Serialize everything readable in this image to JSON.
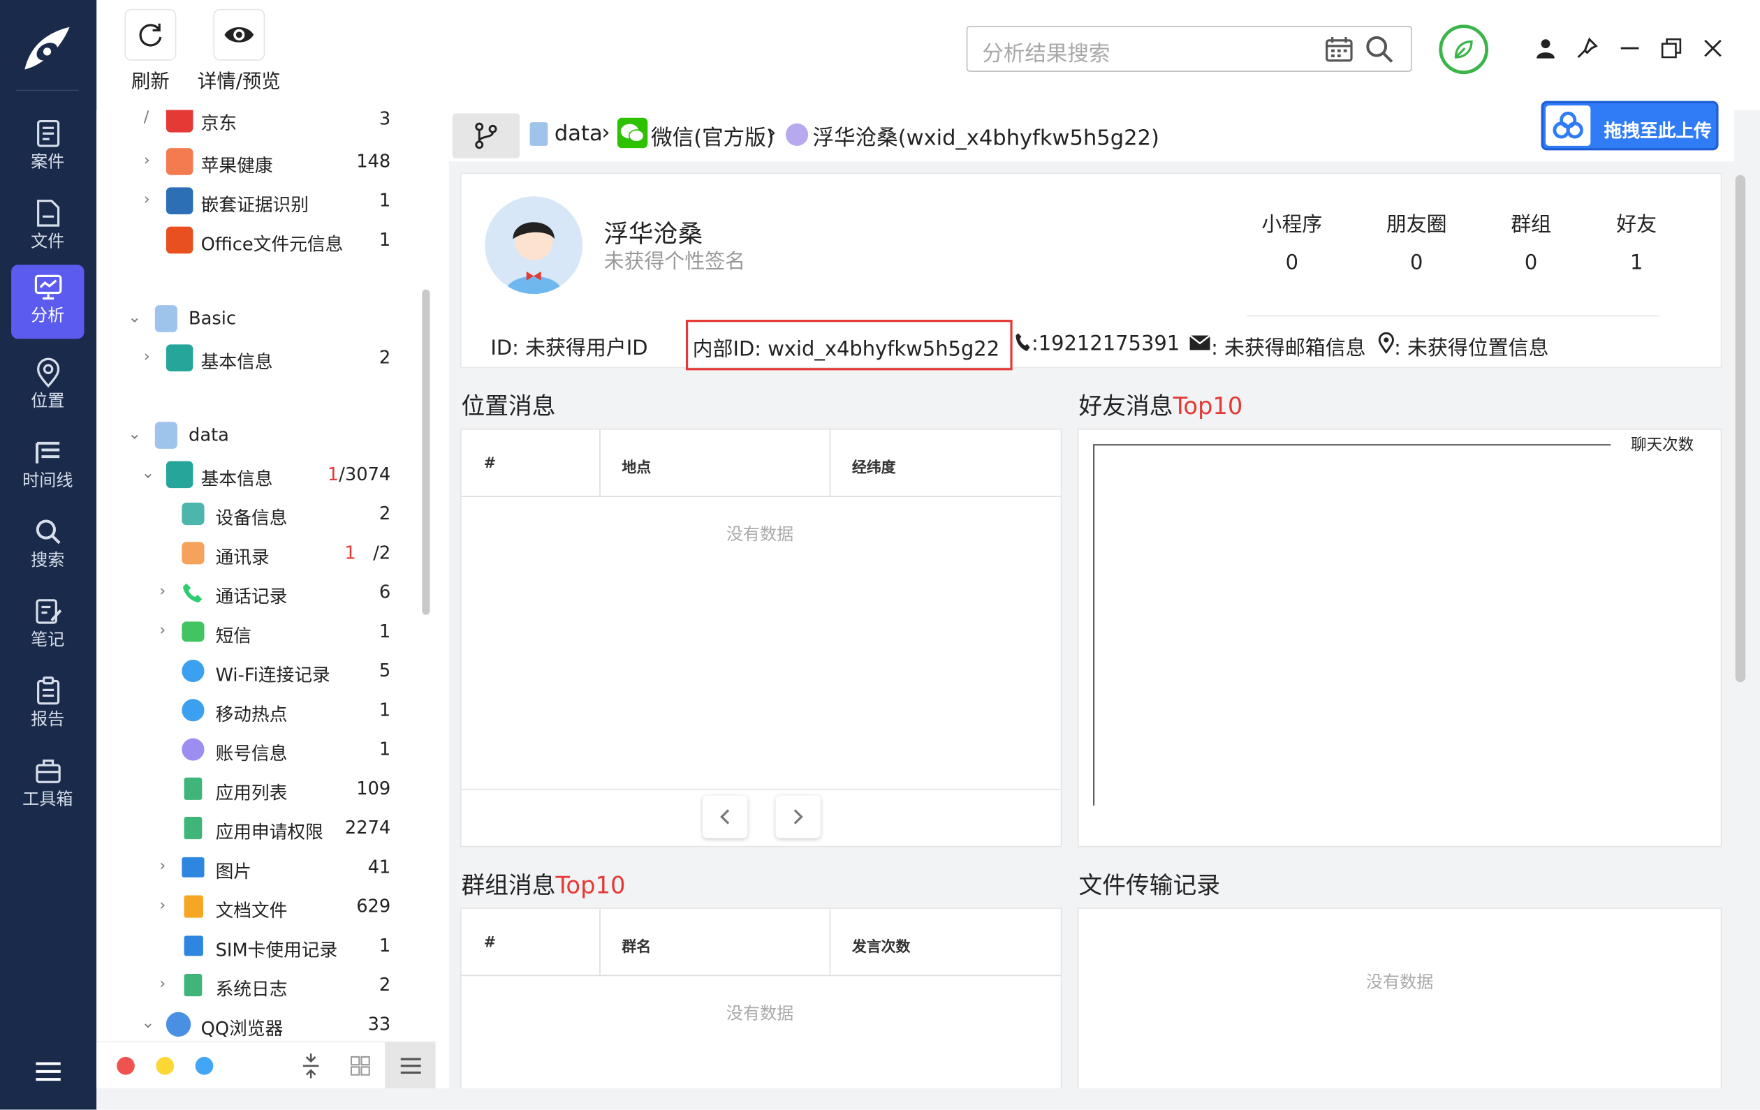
{
  "nav": {
    "items": [
      {
        "label": "案件",
        "icon": "case-icon"
      },
      {
        "label": "文件",
        "icon": "file-icon"
      },
      {
        "label": "分析",
        "icon": "analysis-icon",
        "active": true
      },
      {
        "label": "位置",
        "icon": "location-icon"
      },
      {
        "label": "时间线",
        "icon": "timeline-icon"
      },
      {
        "label": "搜索",
        "icon": "search-icon"
      },
      {
        "label": "笔记",
        "icon": "notes-icon"
      },
      {
        "label": "报告",
        "icon": "report-icon"
      },
      {
        "label": "工具箱",
        "icon": "toolbox-icon"
      }
    ]
  },
  "toolbar": {
    "refresh_label": "刷新",
    "detail_label": "详情/预览",
    "search_placeholder": "分析结果搜索"
  },
  "tree": {
    "rows": [
      {
        "label": "京东",
        "count": "3"
      },
      {
        "label": "苹果健康",
        "count": "148"
      },
      {
        "label": "嵌套证据识别",
        "count": "1"
      },
      {
        "label": "Office文件元信息",
        "count": "1"
      },
      {
        "label": "Basic",
        "count": ""
      },
      {
        "label": "基本信息",
        "count": "2"
      },
      {
        "label": "data",
        "count": ""
      },
      {
        "label": "基本信息",
        "count_red": "1",
        "count": "/3074"
      },
      {
        "label": "设备信息",
        "count": "2"
      },
      {
        "label": "通讯录",
        "count_red": "1",
        "count": "/2"
      },
      {
        "label": "通话记录",
        "count": "6"
      },
      {
        "label": "短信",
        "count": "1"
      },
      {
        "label": "Wi-Fi连接记录",
        "count": "5"
      },
      {
        "label": "移动热点",
        "count": "1"
      },
      {
        "label": "账号信息",
        "count": "1"
      },
      {
        "label": "应用列表",
        "count": "109"
      },
      {
        "label": "应用申请权限",
        "count": "2274"
      },
      {
        "label": "图片",
        "count": "41"
      },
      {
        "label": "文档文件",
        "count": "629"
      },
      {
        "label": "SIM卡使用记录",
        "count": "1"
      },
      {
        "label": "系统日志",
        "count": "2"
      },
      {
        "label": "QQ浏览器",
        "count": "33"
      }
    ]
  },
  "breadcrumb": {
    "seg1": "data",
    "seg2": "微信(官方版)",
    "seg3": "浮华沧桑(wxid_x4bhyfkw5h5g22)",
    "sep": "›"
  },
  "upload_button": "拖拽至此上传",
  "profile": {
    "name": "浮华沧桑",
    "signature": "未获得个性签名",
    "stats": [
      {
        "label": "小程序",
        "value": "0"
      },
      {
        "label": "朋友圈",
        "value": "0"
      },
      {
        "label": "群组",
        "value": "0"
      },
      {
        "label": "好友",
        "value": "1"
      }
    ],
    "id": "ID: 未获得用户ID",
    "internal_id": "内部ID: wxid_x4bhyfkw5h5g22",
    "phone": ":19212175391",
    "email": ": 未获得邮箱信息",
    "location": ": 未获得位置信息"
  },
  "location_panel": {
    "title": "位置消息",
    "columns": [
      "#",
      "地点",
      "经纬度"
    ],
    "empty": "没有数据"
  },
  "friends_panel": {
    "title_main": "好友消息",
    "title_red": "Top10",
    "legend": "聊天次数"
  },
  "group_panel": {
    "title_main": "群组消息",
    "title_red": "Top10",
    "columns": [
      "#",
      "群名",
      "发言次数"
    ],
    "empty": "没有数据"
  },
  "file_panel": {
    "title": "文件传输记录",
    "empty": "没有数据"
  },
  "colors": {
    "nav_bg": "#1a2a4a",
    "nav_active": "#5b5bf0",
    "accent_red": "#e53935",
    "upload_blue": "#2f7cf6"
  }
}
